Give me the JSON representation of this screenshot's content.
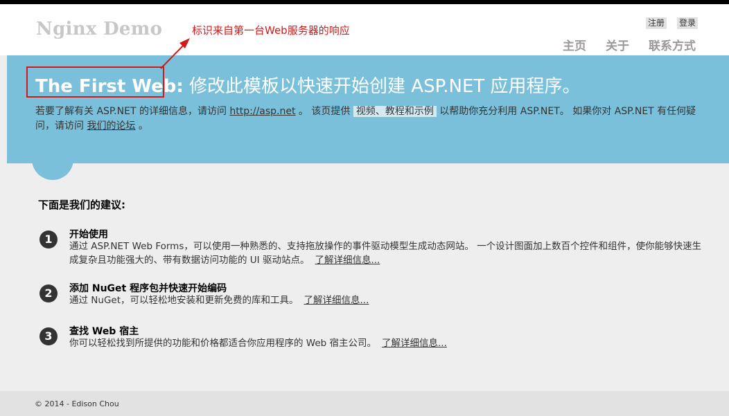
{
  "header": {
    "logo": "Nginx Demo",
    "annotation": "标识来自第一台Web服务器的响应",
    "auth": {
      "register": "注册",
      "login": "登录"
    },
    "nav": {
      "home": "主页",
      "about": "关于",
      "contact": "联系方式"
    }
  },
  "hero": {
    "title_strong": "The First Web:",
    "title_rest": " 修改此模板以快速开始创建 ASP.NET 应用程序。",
    "intro_1": "若要了解有关 ASP.NET 的详细信息，请访问 ",
    "link_asp": "http://asp.net",
    "intro_2": " 。 该页提供 ",
    "link_videos": "视频、教程和示例",
    "intro_3": " 以帮助你充分利用 ASP.NET。 如果你对 ASP.NET 有任何疑问，请访问 ",
    "link_forum": "我们的论坛",
    "intro_4": " 。"
  },
  "suggestions": {
    "heading": "下面是我们的建议:",
    "items": [
      {
        "num": "1",
        "title": "开始使用",
        "desc": "通过 ASP.NET Web Forms，可以使用一种熟悉的、支持拖放操作的事件驱动模型生成动态网站。 一个设计图面加上数百个控件和组件，使你能够快速生成复杂且功能强大的、带有数据访问功能的 UI 驱动站点。",
        "link": "了解详细信息..."
      },
      {
        "num": "2",
        "title": "添加 NuGet 程序包并快速开始编码",
        "desc": "通过 NuGet，可以轻松地安装和更新免费的库和工具。",
        "link": "了解详细信息..."
      },
      {
        "num": "3",
        "title": "查找 Web 宿主",
        "desc": "你可以轻松找到所提供的功能和价格都适合你应用程序的 Web 宿主公司。",
        "link": "了解详细信息..."
      }
    ]
  },
  "footer": {
    "copyright": "© 2014 - Edison Chou"
  },
  "colors": {
    "featured": "#7ac0da",
    "annotation": "#d21a1a",
    "background": "#efeeef"
  }
}
